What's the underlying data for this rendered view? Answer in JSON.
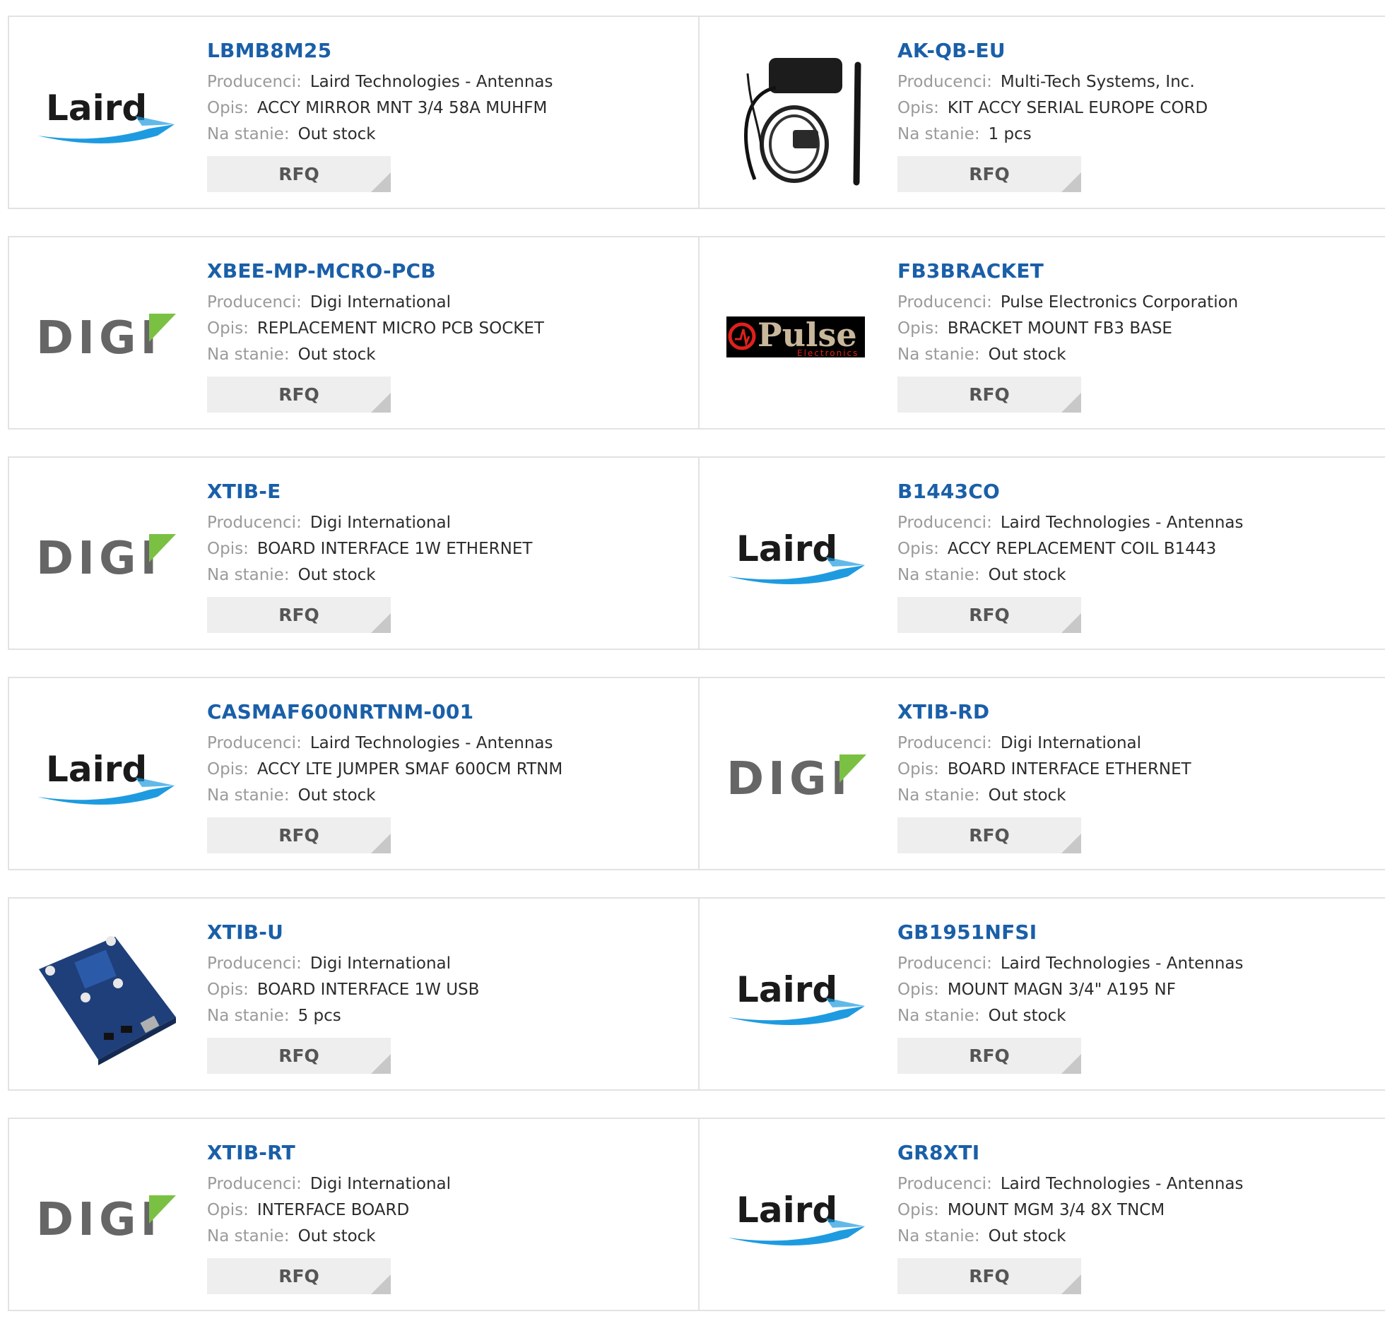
{
  "labels": {
    "manufacturer": "Producenci:",
    "description": "Opis:",
    "stock": "Na stanie:",
    "rfq": "RFQ"
  },
  "brand_logos": {
    "laird": {
      "text": "Laird",
      "color": "#1a1a1a",
      "swoosh": "#1e9be0"
    },
    "digi": {
      "text": "DIGI",
      "color": "#666666",
      "accent": "#7ac143"
    },
    "pulse": {
      "text": "Pulse",
      "subtext": "Electronics",
      "bg": "#000000",
      "color": "#c8b79a",
      "accent": "#e0201b"
    }
  },
  "colors": {
    "part_number": "#1a5fa8",
    "label": "#9a9a9a",
    "button_bg": "#eeeeee",
    "border": "#e2e2e2"
  },
  "rows": [
    [
      {
        "part": "LBMB8M25",
        "manufacturer": "Laird Technologies - Antennas",
        "description": "ACCY MIRROR MNT 3/4 58A MUHFM",
        "stock": "Out stock",
        "image": "laird-logo"
      },
      {
        "part": "AK-QB-EU",
        "manufacturer": "Multi-Tech Systems, Inc.",
        "description": "KIT ACCY SERIAL EUROPE CORD",
        "stock": "1 pcs",
        "image": "cable-kit-photo"
      }
    ],
    [
      {
        "part": "XBEE-MP-MCRO-PCB",
        "manufacturer": "Digi International",
        "description": "REPLACEMENT MICRO PCB SOCKET",
        "stock": "Out stock",
        "image": "digi-logo"
      },
      {
        "part": "FB3BRACKET",
        "manufacturer": "Pulse Electronics Corporation",
        "description": "BRACKET MOUNT FB3 BASE",
        "stock": "Out stock",
        "image": "pulse-logo"
      }
    ],
    [
      {
        "part": "XTIB-E",
        "manufacturer": "Digi International",
        "description": "BOARD INTERFACE 1W ETHERNET",
        "stock": "Out stock",
        "image": "digi-logo"
      },
      {
        "part": "B1443CO",
        "manufacturer": "Laird Technologies - Antennas",
        "description": "ACCY REPLACEMENT COIL B1443",
        "stock": "Out stock",
        "image": "laird-logo"
      }
    ],
    [
      {
        "part": "CASMAF600NRTNM-001",
        "manufacturer": "Laird Technologies - Antennas",
        "description": "ACCY LTE JUMPER SMAF 600CM RTNM",
        "stock": "Out stock",
        "image": "laird-logo"
      },
      {
        "part": "XTIB-RD",
        "manufacturer": "Digi International",
        "description": "BOARD INTERFACE ETHERNET",
        "stock": "Out stock",
        "image": "digi-logo"
      }
    ],
    [
      {
        "part": "XTIB-U",
        "manufacturer": "Digi International",
        "description": "BOARD INTERFACE 1W USB",
        "stock": "5 pcs",
        "image": "pcb-board-photo"
      },
      {
        "part": "GB1951NFSI",
        "manufacturer": "Laird Technologies - Antennas",
        "description": "MOUNT MAGN 3/4\" A195 NF",
        "stock": "Out stock",
        "image": "laird-logo"
      }
    ],
    [
      {
        "part": "XTIB-RT",
        "manufacturer": "Digi International",
        "description": "INTERFACE BOARD",
        "stock": "Out stock",
        "image": "digi-logo"
      },
      {
        "part": "GR8XTI",
        "manufacturer": "Laird Technologies - Antennas",
        "description": "MOUNT MGM 3/4 8X TNCM",
        "stock": "Out stock",
        "image": "laird-logo"
      }
    ]
  ]
}
